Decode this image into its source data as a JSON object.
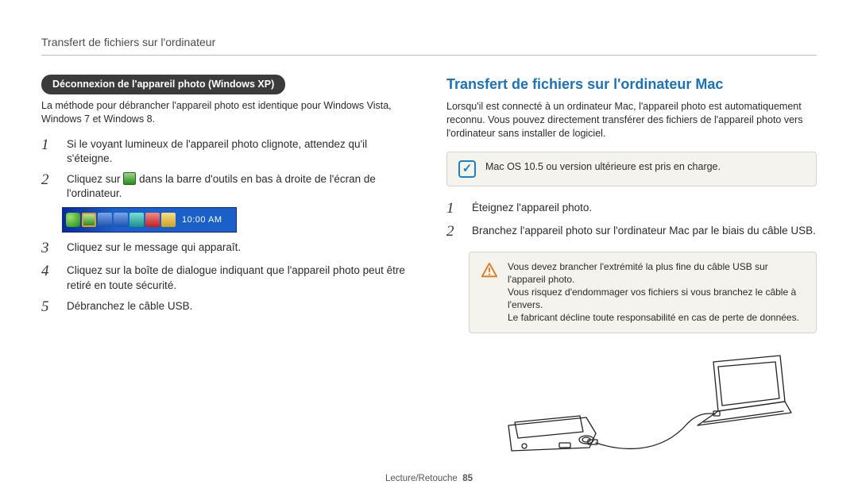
{
  "header": {
    "title": "Transfert de fichiers sur l'ordinateur"
  },
  "left": {
    "pill": "Déconnexion de l'appareil photo (Windows XP)",
    "intro": "La méthode pour débrancher l'appareil photo est identique pour Windows Vista, Windows 7 et Windows 8.",
    "steps": [
      "Si le voyant lumineux de l'appareil photo clignote, attendez qu'il s'éteigne.",
      "Cliquez sur [icon] dans la barre d'outils en bas à droite de l'écran de l'ordinateur.",
      "Cliquez sur le message qui apparaît.",
      "Cliquez sur la boîte de dialogue indiquant que l'appareil photo peut être retiré en toute sécurité.",
      "Débranchez le câble USB."
    ],
    "step2_pre": "Cliquez sur",
    "step2_post": "dans la barre d'outils en bas à droite de l'écran de l'ordinateur.",
    "tray_time": "10:00 AM"
  },
  "right": {
    "title": "Transfert de fichiers sur l'ordinateur Mac",
    "intro": "Lorsqu'il est connecté à un ordinateur Mac, l'appareil photo est automatiquement reconnu. Vous pouvez directement transférer des fichiers de l'appareil photo vers l'ordinateur sans installer de logiciel.",
    "info": "Mac OS 10.5 ou version ultérieure est pris en charge.",
    "steps": [
      "Éteignez l'appareil photo.",
      "Branchez l'appareil photo sur l'ordinateur Mac par le biais du câble USB."
    ],
    "warn_lines": [
      "Vous devez brancher l'extrémité la plus fine du câble USB sur l'appareil photo.",
      "Vous risquez d'endommager vos fichiers si vous branchez le câble à l'envers.",
      "Le fabricant décline toute responsabilité en cas de perte de données."
    ]
  },
  "footer": {
    "section": "Lecture/Retouche",
    "page": "85"
  }
}
